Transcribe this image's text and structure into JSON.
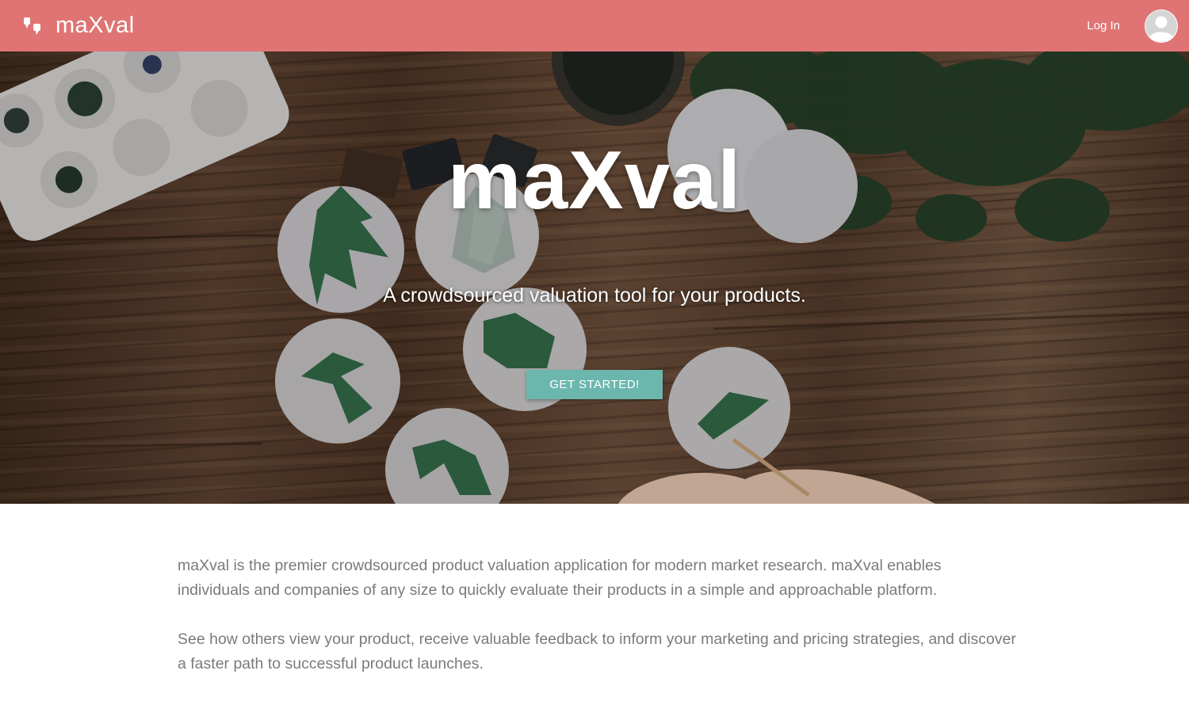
{
  "navbar": {
    "brand_name": "maXval",
    "brand_icon": "quote-bubble-icon",
    "login_label": "Log In",
    "avatar_icon": "user-avatar-icon",
    "background_color": "#e07474"
  },
  "hero": {
    "title": "maXval",
    "subtitle": "A crowdsourced valuation tool for your products.",
    "cta_label": "GET STARTED!",
    "cta_color": "#6cb7ad"
  },
  "about": {
    "paragraph_1": "maXval is the premier crowdsourced product valuation application for modern market research. maXval enables individuals and companies of any size to quickly evaluate their products in a simple and approachable platform.",
    "paragraph_2": "See how others view your product, receive valuable feedback to inform your marketing and pricing strategies, and discover a faster path to successful product launches.",
    "text_color": "#7a7a7a"
  }
}
